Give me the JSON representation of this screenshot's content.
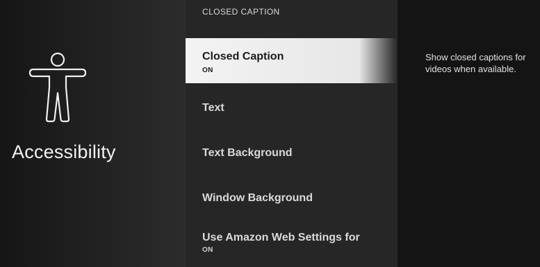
{
  "left": {
    "icon": "accessibility-person-icon",
    "title": "Accessibility"
  },
  "menu": {
    "header": "CLOSED CAPTION",
    "items": [
      {
        "label": "Closed Caption",
        "value": "ON",
        "selected": true
      },
      {
        "label": "Text",
        "value": ""
      },
      {
        "label": "Text Background",
        "value": ""
      },
      {
        "label": "Window Background",
        "value": ""
      },
      {
        "label": "Use Amazon Web Settings for",
        "value": "ON"
      }
    ]
  },
  "description": "Show closed captions for videos when available.",
  "colors": {
    "selected_bg": "#eeeeee",
    "menu_bg": "#262626",
    "left_bg": "#222222",
    "right_bg": "#141414"
  }
}
